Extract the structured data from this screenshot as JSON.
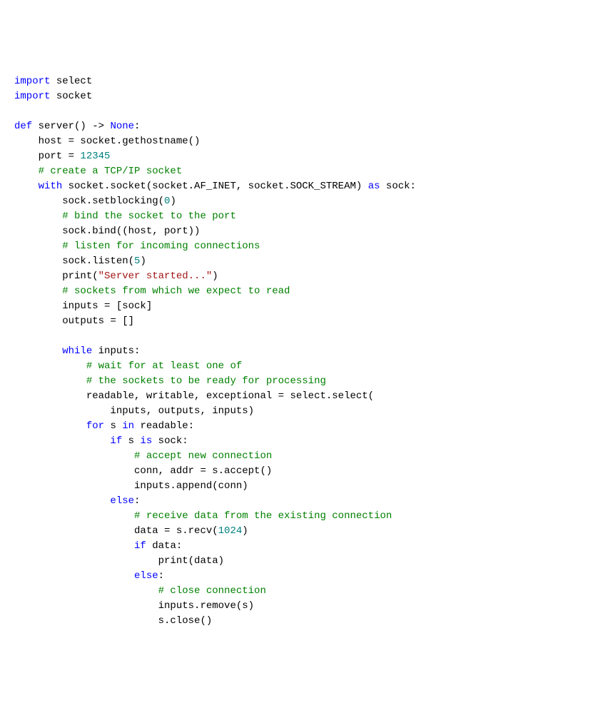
{
  "code": {
    "line1": {
      "kw1": "import",
      "name1": " select"
    },
    "line2": {
      "kw1": "import",
      "name1": " socket"
    },
    "line3": {
      "kw1": "def",
      "name1": " server() -> ",
      "type1": "None",
      "name2": ":"
    },
    "line4": "    host = socket.gethostname()",
    "line5": {
      "text1": "    port = ",
      "num1": "12345"
    },
    "line6": {
      "comment": "    # create a TCP/IP socket"
    },
    "line7": {
      "indent": "    ",
      "kw1": "with",
      "text1": " socket.socket(socket.AF_INET, socket.SOCK_STREAM) ",
      "kw2": "as",
      "text2": " sock:"
    },
    "line8": {
      "text1": "        sock.setblocking(",
      "num1": "0",
      "text2": ")"
    },
    "line9": {
      "comment": "        # bind the socket to the port"
    },
    "line10": "        sock.bind((host, port))",
    "line11": {
      "comment": "        # listen for incoming connections"
    },
    "line12": {
      "text1": "        sock.listen(",
      "num1": "5",
      "text2": ")"
    },
    "line13": {
      "text1": "        print(",
      "str1": "\"Server started...\"",
      "text2": ")"
    },
    "line14": {
      "comment": "        # sockets from which we expect to read"
    },
    "line15": "        inputs = [sock]",
    "line16": "        outputs = []",
    "line17": "",
    "line18": {
      "indent": "        ",
      "kw1": "while",
      "text1": " inputs:"
    },
    "line19": {
      "comment": "            # wait for at least one of"
    },
    "line20": {
      "comment": "            # the sockets to be ready for processing"
    },
    "line21": "            readable, writable, exceptional = select.select(",
    "line22": "                inputs, outputs, inputs)",
    "line23": {
      "indent": "            ",
      "kw1": "for",
      "text1": " s ",
      "kw2": "in",
      "text2": " readable:"
    },
    "line24": {
      "indent": "                ",
      "kw1": "if",
      "text1": " s ",
      "kw2": "is",
      "text2": " sock:"
    },
    "line25": {
      "comment": "                    # accept new connection"
    },
    "line26": "                    conn, addr = s.accept()",
    "line27": "                    inputs.append(conn)",
    "line28": {
      "indent": "                ",
      "kw1": "else",
      "text1": ":"
    },
    "line29": {
      "comment": "                    # receive data from the existing connection"
    },
    "line30": {
      "text1": "                    data = s.recv(",
      "num1": "1024",
      "text2": ")"
    },
    "line31": {
      "indent": "                    ",
      "kw1": "if",
      "text1": " data:"
    },
    "line32": "                        print(data)",
    "line33": {
      "indent": "                    ",
      "kw1": "else",
      "text1": ":"
    },
    "line34": {
      "comment": "                        # close connection"
    },
    "line35": "                        inputs.remove(s)",
    "line36": "                        s.close()"
  }
}
